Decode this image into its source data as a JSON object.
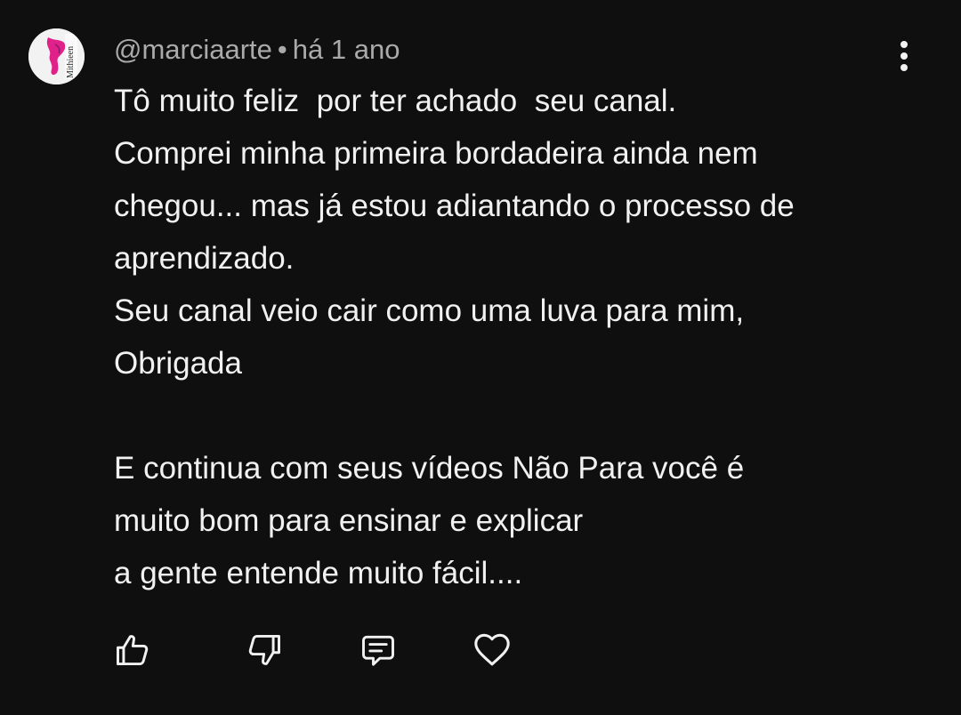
{
  "comment": {
    "author": "@marciaarte",
    "separator": "•",
    "time": "há 1 ano",
    "avatar_text": "Mithieen",
    "text": "Tô muito feliz  por ter achado  seu canal.\nComprei minha primeira bordadeira ainda nem\nchegou... mas já estou adiantando o processo de\naprendizado.\nSeu canal veio cair como uma luva para mim,\nObrigada\n\nE continua com seus vídeos Não Para você é\nmuito bom para ensinar e explicar\na gente entende muito fácil...."
  },
  "actions": [
    {
      "name": "like",
      "icon": "thumb-up-icon"
    },
    {
      "name": "dislike",
      "icon": "thumb-down-icon"
    },
    {
      "name": "reply",
      "icon": "comment-icon"
    },
    {
      "name": "heart",
      "icon": "heart-icon"
    }
  ],
  "colors": {
    "background": "#0f0f0f",
    "text": "#f1f1f1",
    "meta": "#aaaaaa",
    "avatar_accent": "#e0218a"
  }
}
